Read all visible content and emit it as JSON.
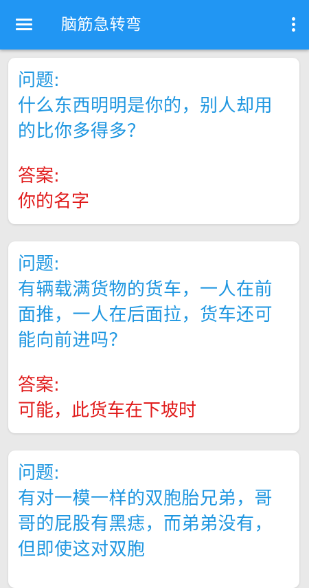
{
  "appbar": {
    "title": "脑筋急转弯",
    "menu_icon": "hamburger-menu-icon",
    "overflow_icon": "more-vert-icon",
    "color": "#2196f3"
  },
  "colors": {
    "question": "#1e96e0",
    "answer": "#e01b1b",
    "background": "#e9e9e9"
  },
  "cards": [
    {
      "question_label": "问题:",
      "question": "什么东西明明是你的，别人却用的比你多得多？",
      "answer_label": "答案:",
      "answer": "你的名字"
    },
    {
      "question_label": "问题:",
      "question": "有辆载满货物的货车，一人在前面推，一人在后面拉，货车还可能向前进吗？",
      "answer_label": "答案:",
      "answer": "可能，此货车在下坡时"
    },
    {
      "question_label": "问题:",
      "question": "有对一模一样的双胞胎兄弟，哥哥的屁股有黑痣，而弟弟没有，但即使这对双胞"
    }
  ]
}
